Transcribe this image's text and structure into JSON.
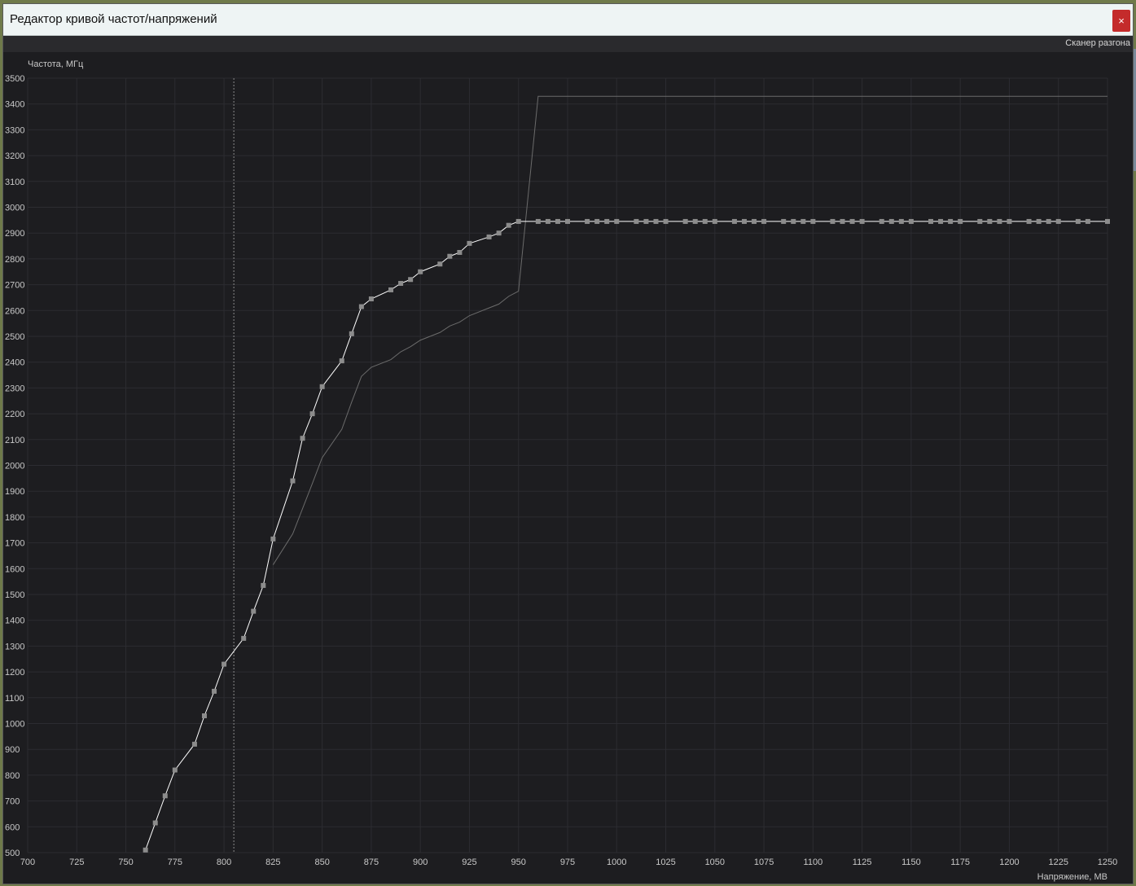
{
  "window": {
    "title": "Редактор кривой частот/напряжений",
    "close_glyph": "×",
    "scanner_label": "Сканер разгона"
  },
  "colors": {
    "background": "#1d1d20",
    "grid": "#2c2c31",
    "axis_text": "#c8c8c8",
    "curve": "#ffffff",
    "point": "#8c8c8c",
    "reference": "#6b6b6b",
    "close_button": "#c42b2b"
  },
  "chart_data": {
    "type": "line",
    "xlabel": "Напряжение, МВ",
    "ylabel": "Частота, МГц",
    "xlim": [
      700,
      1250
    ],
    "ylim": [
      500,
      3500
    ],
    "xticks": [
      700,
      725,
      750,
      775,
      800,
      825,
      850,
      875,
      900,
      925,
      950,
      975,
      1000,
      1025,
      1050,
      1075,
      1100,
      1125,
      1150,
      1175,
      1200,
      1225,
      1250
    ],
    "yticks": [
      500,
      600,
      700,
      800,
      900,
      1000,
      1100,
      1200,
      1300,
      1400,
      1500,
      1600,
      1700,
      1800,
      1900,
      2000,
      2100,
      2200,
      2300,
      2400,
      2500,
      2600,
      2700,
      2800,
      2900,
      3000,
      3100,
      3200,
      3300,
      3400,
      3500
    ],
    "grid": true,
    "marker_line_voltage": 805,
    "series": [
      {
        "style": "curve-with-points",
        "points": [
          [
            760,
            510
          ],
          [
            765,
            615
          ],
          [
            770,
            720
          ],
          [
            775,
            820
          ],
          [
            785,
            920
          ],
          [
            790,
            1030
          ],
          [
            795,
            1125
          ],
          [
            800,
            1230
          ],
          [
            810,
            1330
          ],
          [
            815,
            1435
          ],
          [
            820,
            1535
          ],
          [
            825,
            1715
          ],
          [
            835,
            1940
          ],
          [
            840,
            2105
          ],
          [
            845,
            2200
          ],
          [
            850,
            2305
          ],
          [
            860,
            2405
          ],
          [
            865,
            2510
          ],
          [
            870,
            2615
          ],
          [
            875,
            2645
          ],
          [
            885,
            2680
          ],
          [
            890,
            2705
          ],
          [
            895,
            2720
          ],
          [
            900,
            2750
          ],
          [
            910,
            2780
          ],
          [
            915,
            2810
          ],
          [
            920,
            2825
          ],
          [
            925,
            2860
          ],
          [
            935,
            2885
          ],
          [
            940,
            2900
          ],
          [
            945,
            2930
          ],
          [
            950,
            2945
          ],
          [
            960,
            2945
          ],
          [
            965,
            2945
          ],
          [
            970,
            2945
          ],
          [
            975,
            2945
          ],
          [
            985,
            2945
          ],
          [
            990,
            2945
          ],
          [
            995,
            2945
          ],
          [
            1000,
            2945
          ],
          [
            1010,
            2945
          ],
          [
            1015,
            2945
          ],
          [
            1020,
            2945
          ],
          [
            1025,
            2945
          ],
          [
            1035,
            2945
          ],
          [
            1040,
            2945
          ],
          [
            1045,
            2945
          ],
          [
            1050,
            2945
          ],
          [
            1060,
            2945
          ],
          [
            1065,
            2945
          ],
          [
            1070,
            2945
          ],
          [
            1075,
            2945
          ],
          [
            1085,
            2945
          ],
          [
            1090,
            2945
          ],
          [
            1095,
            2945
          ],
          [
            1100,
            2945
          ],
          [
            1110,
            2945
          ],
          [
            1115,
            2945
          ],
          [
            1120,
            2945
          ],
          [
            1125,
            2945
          ],
          [
            1135,
            2945
          ],
          [
            1140,
            2945
          ],
          [
            1145,
            2945
          ],
          [
            1150,
            2945
          ],
          [
            1160,
            2945
          ],
          [
            1165,
            2945
          ],
          [
            1170,
            2945
          ],
          [
            1175,
            2945
          ],
          [
            1185,
            2945
          ],
          [
            1190,
            2945
          ],
          [
            1195,
            2945
          ],
          [
            1200,
            2945
          ],
          [
            1210,
            2945
          ],
          [
            1215,
            2945
          ],
          [
            1220,
            2945
          ],
          [
            1225,
            2945
          ],
          [
            1235,
            2945
          ],
          [
            1240,
            2945
          ],
          [
            1250,
            2945
          ]
        ]
      },
      {
        "style": "reference-line",
        "points": [
          [
            825,
            1615
          ],
          [
            835,
            1735
          ],
          [
            845,
            1930
          ],
          [
            850,
            2030
          ],
          [
            860,
            2140
          ],
          [
            865,
            2245
          ],
          [
            870,
            2345
          ],
          [
            875,
            2380
          ],
          [
            885,
            2410
          ],
          [
            890,
            2440
          ],
          [
            895,
            2460
          ],
          [
            900,
            2485
          ],
          [
            910,
            2515
          ],
          [
            915,
            2540
          ],
          [
            920,
            2555
          ],
          [
            925,
            2580
          ],
          [
            935,
            2610
          ],
          [
            940,
            2625
          ],
          [
            945,
            2655
          ],
          [
            950,
            2675
          ],
          [
            960,
            3430
          ],
          [
            1250,
            3430
          ]
        ]
      }
    ]
  }
}
